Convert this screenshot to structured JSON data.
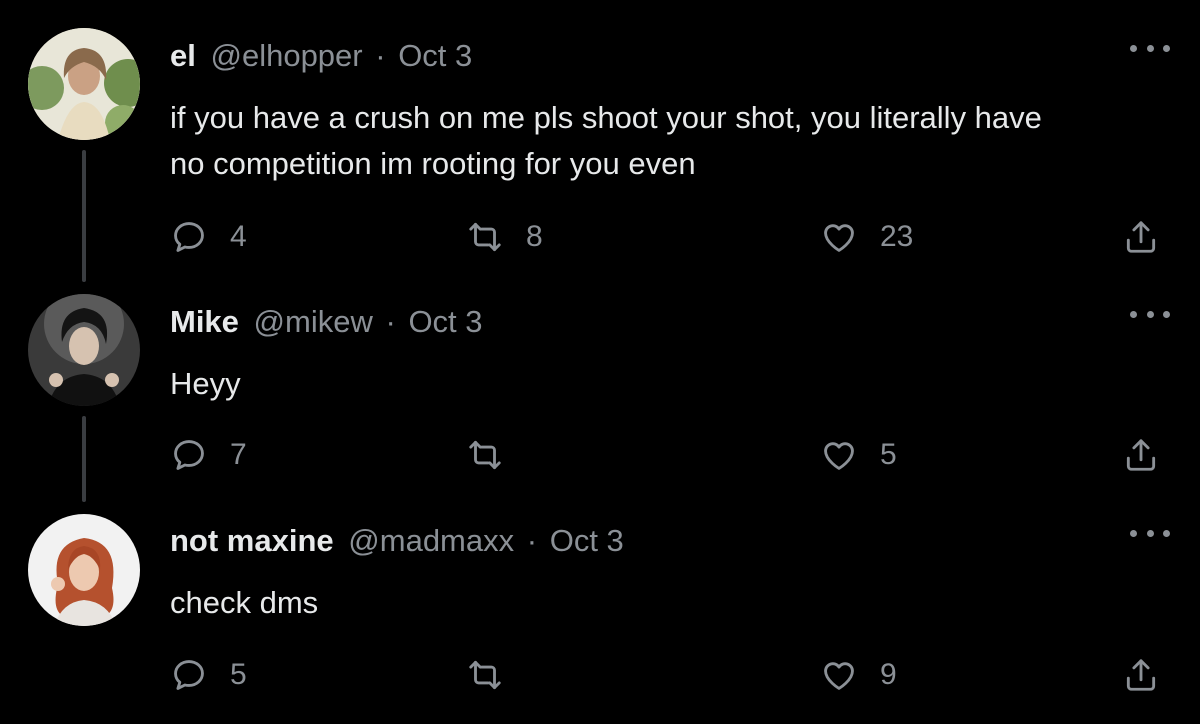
{
  "tweets": [
    {
      "name": "el",
      "handle": "@elhopper",
      "dot": "·",
      "date": "Oct 3",
      "text_lines": [
        "if you have a crush on me pls shoot your shot, you literally have",
        "no competition im rooting for you even"
      ],
      "replies": "4",
      "retweets": "8",
      "likes": "23"
    },
    {
      "name": "Mike",
      "handle": "@mikew",
      "dot": "·",
      "date": "Oct 3",
      "text_lines": [
        "Heyy"
      ],
      "replies": "7",
      "retweets": "",
      "likes": "5"
    },
    {
      "name": "not maxine",
      "handle": "@madmaxx",
      "dot": "·",
      "date": "Oct 3",
      "text_lines": [
        "check dms"
      ],
      "replies": "5",
      "retweets": "",
      "likes": "9"
    }
  ],
  "colors": {
    "background": "#000000",
    "text": "#e7e9ea",
    "secondary": "#8b9096",
    "thread_line": "#3a3d41"
  },
  "icons": [
    "reply-icon",
    "retweet-icon",
    "like-icon",
    "share-icon",
    "more-icon"
  ]
}
